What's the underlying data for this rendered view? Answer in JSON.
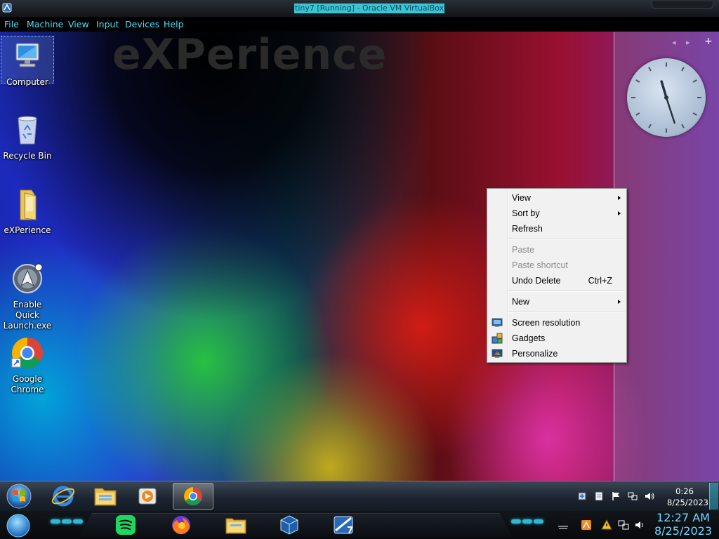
{
  "window": {
    "title": "tiny7 [Running] - Oracle VM VirtualBox"
  },
  "menu": [
    "File",
    "Machine",
    "View",
    "Input",
    "Devices",
    "Help"
  ],
  "desktop": {
    "wallpaper_text": "eXPerience",
    "icons": [
      {
        "label": "Computer",
        "icon": "computer-icon"
      },
      {
        "label": "Recycle Bin",
        "icon": "recycle-bin-icon"
      },
      {
        "label": "eXPerience",
        "icon": "folder-icon"
      },
      {
        "label": "Enable Quick Launch.exe",
        "icon": "quick-launch-icon"
      },
      {
        "label": "Google Chrome",
        "icon": "chrome-icon"
      }
    ]
  },
  "gadgets": {
    "clock": {
      "hour": 11,
      "minute": 27
    }
  },
  "context_menu": {
    "items": [
      {
        "label": "View",
        "submenu": true
      },
      {
        "label": "Sort by",
        "submenu": true
      },
      {
        "label": "Refresh"
      },
      {
        "label": "Paste",
        "disabled": true
      },
      {
        "label": "Paste shortcut",
        "disabled": true
      },
      {
        "label": "Undo Delete",
        "shortcut": "Ctrl+Z"
      },
      {
        "label": "New",
        "submenu": true
      },
      {
        "label": "Screen resolution",
        "icon": "screen-resolution-icon"
      },
      {
        "label": "Gadgets",
        "icon": "gadgets-icon"
      },
      {
        "label": "Personalize",
        "icon": "personalize-icon"
      }
    ]
  },
  "taskbar": {
    "pinned": [
      "start-orb-icon",
      "internet-explorer-icon",
      "file-explorer-icon",
      "media-player-icon",
      "chrome-icon"
    ],
    "clock": {
      "time": "0:26",
      "date": "8/25/2023"
    }
  },
  "dock": {
    "apps": [
      "spotify-icon",
      "firefox-icon",
      "file-explorer-icon",
      "virtualbox-icon",
      "tiny7-vm-icon"
    ],
    "clock": {
      "time": "12:27 AM",
      "date": "8/25/2023"
    }
  },
  "colors": {
    "menu_text": "#4ce0ff",
    "dock_clock": "#6fd9ff",
    "title_highlight": "#3dc4d4"
  }
}
